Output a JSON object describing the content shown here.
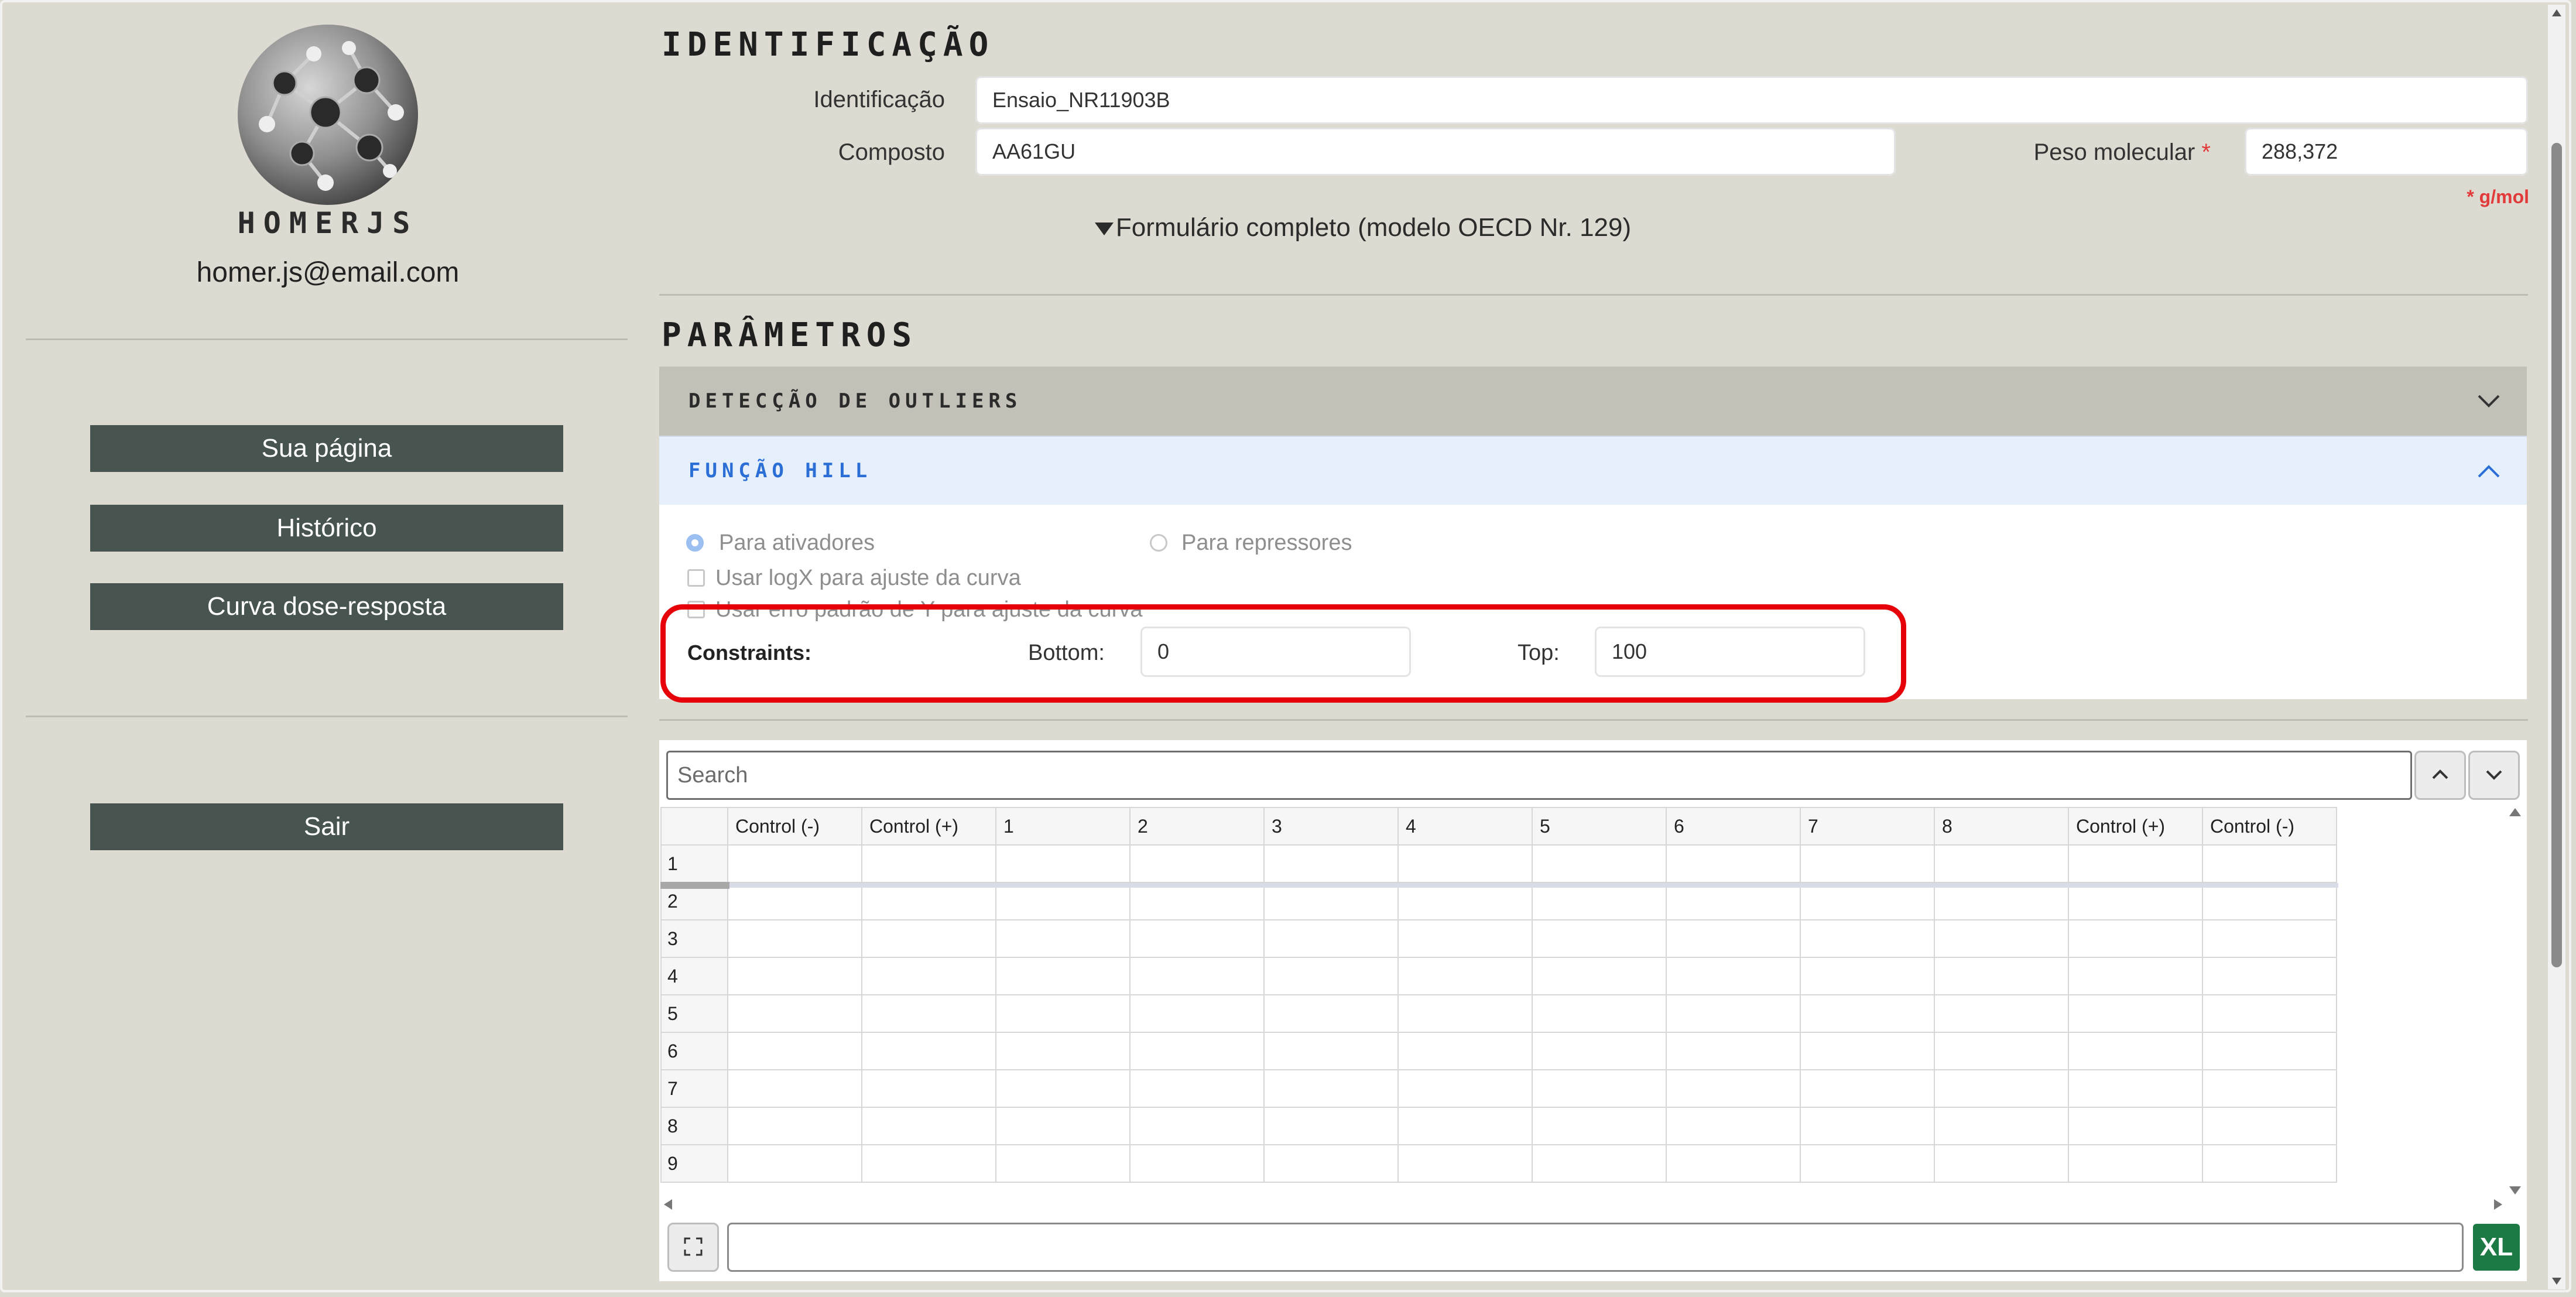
{
  "user": {
    "name": "HOMERJS",
    "email": "homer.js@email.com"
  },
  "nav": {
    "home": "Sua página",
    "history": "Histórico",
    "dose_response": "Curva dose-resposta",
    "logout": "Sair"
  },
  "identificacao": {
    "title": "IDENTIFICAÇÃO",
    "id_label": "Identificação",
    "id_value": "Ensaio_NR11903B",
    "compound_label": "Composto",
    "compound_value": "AA61GU",
    "mw_label": "Peso molecular",
    "mw_required": "*",
    "mw_value": "288,372",
    "mw_unit": "* g/mol",
    "full_form": "Formulário completo (modelo OECD Nr. 129)"
  },
  "parametros": {
    "title": "PARÂMETROS",
    "outliers": "DETECÇÃO DE OUTLIERS",
    "hill": "FUNÇÃO HILL",
    "opt_activators": "Para ativadores",
    "opt_repressors": "Para repressores",
    "opt_logx": "Usar logX para ajuste da curva",
    "opt_stderr": "Usar erro padrão de Y para ajuste da curva",
    "constraints_label": "Constraints:",
    "bottom_label": "Bottom:",
    "bottom_value": "0",
    "top_label": "Top:",
    "top_value": "100"
  },
  "grid": {
    "search_placeholder": "Search",
    "columns": [
      "Control (-)",
      "Control (+)",
      "1",
      "2",
      "3",
      "4",
      "5",
      "6",
      "7",
      "8",
      "Control (+)",
      "Control (-)"
    ],
    "rows": [
      "1",
      "2",
      "3",
      "4",
      "5",
      "6",
      "7",
      "8",
      "9"
    ],
    "xl_label": "XL"
  },
  "colors": {
    "background": "#dddbd1",
    "nav_button": "#48544f",
    "accent_blue": "#2b6fd6",
    "highlight": "#e6000a",
    "excel": "#1d7a45"
  }
}
